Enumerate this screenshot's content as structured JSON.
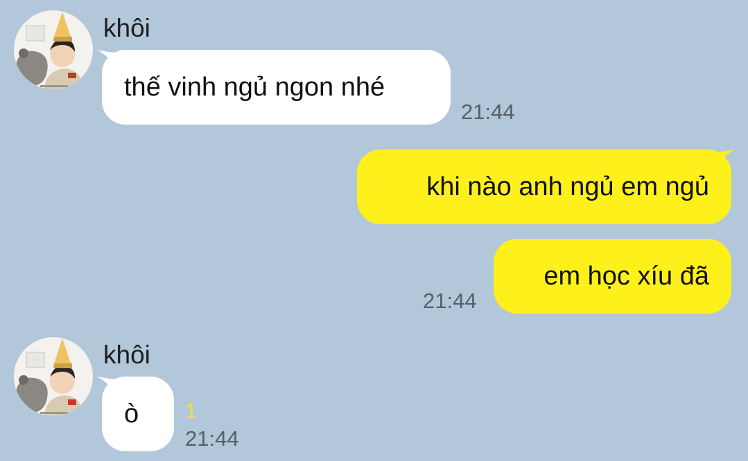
{
  "colors": {
    "background": "#b2c7d9",
    "incoming_bubble": "#ffffff",
    "outgoing_bubble": "#fef01b",
    "timestamp": "#556068",
    "unread_count": "#f2e52b"
  },
  "messages": [
    {
      "direction": "incoming",
      "sender": "khôi",
      "avatar_icon": "profile-photo-icon",
      "text": "thế vinh ngủ ngon nhé",
      "time": "21:44"
    },
    {
      "direction": "outgoing",
      "text": "khi nào anh ngủ em ngủ"
    },
    {
      "direction": "outgoing",
      "text": "em học xíu đã",
      "time": "21:44"
    },
    {
      "direction": "incoming",
      "sender": "khôi",
      "avatar_icon": "profile-photo-icon",
      "text": "ò",
      "unread": "1",
      "time": "21:44"
    }
  ]
}
